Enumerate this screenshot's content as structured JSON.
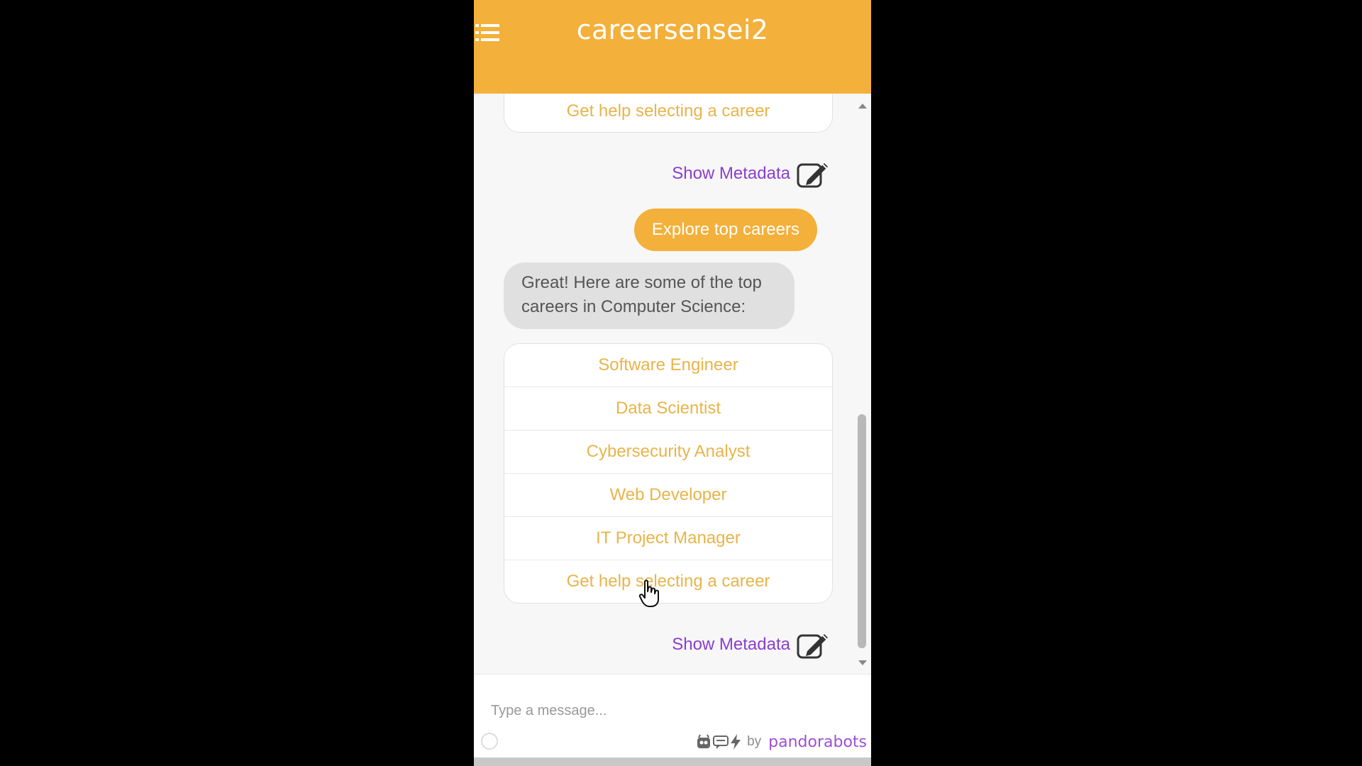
{
  "header": {
    "title": "careersensei2",
    "menu_icon": "hamburger-menu-icon",
    "background_color": "#f3b03a"
  },
  "chat": {
    "prev_option": "Get help selecting a career",
    "metadata_label_1": "Show Metadata",
    "metadata_label_2": "Show Metadata",
    "edit_icon": "edit-note-icon",
    "user_message": "Explore top careers",
    "bot_message": "Great! Here are some of the top careers in Computer Science:",
    "options": [
      "Software Engineer",
      "Data Scientist",
      "Cybersecurity Analyst",
      "Web Developer",
      "IT Project Manager",
      "Get help selecting a career"
    ],
    "accent_color": "#f3b03a",
    "option_text_color": "#e8b44a",
    "metadata_color": "#8a3ecf"
  },
  "composer": {
    "placeholder": "Type a message...",
    "emoji_icon": "emoji-icon",
    "brand_by": "by",
    "brand_name": "pandorabots",
    "brand_color": "#9c4fd6"
  }
}
